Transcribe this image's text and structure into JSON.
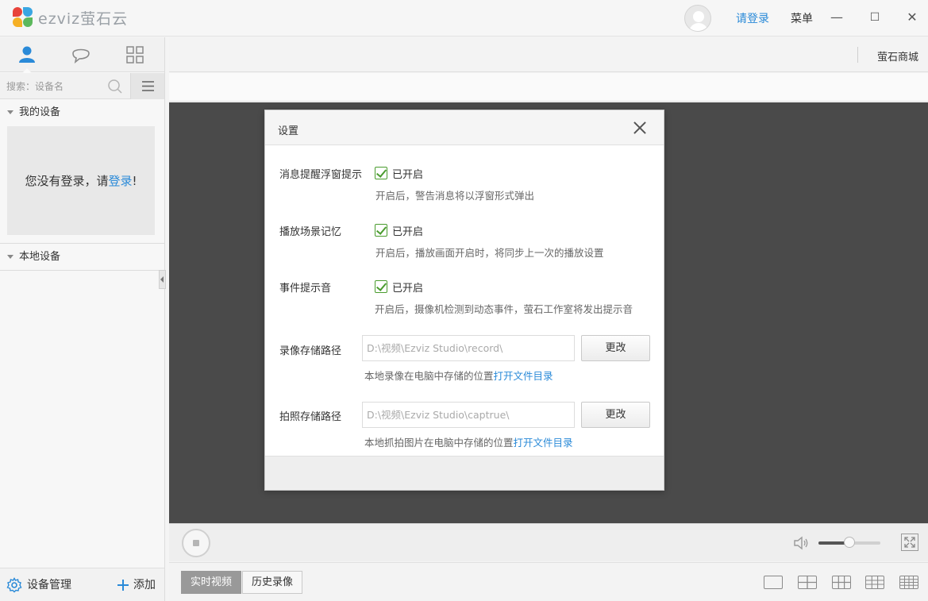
{
  "app": {
    "logo_text": "ezviz萤石云",
    "login_label": "请登录",
    "menu_label": "菜单",
    "minimize_glyph": "—",
    "maximize_glyph": "☐",
    "close_glyph": "✕"
  },
  "sidebar": {
    "tabs": [
      {
        "name": "user-icon"
      },
      {
        "name": "chat-icon"
      },
      {
        "name": "grid-icon"
      }
    ],
    "search_placeholder": "搜索：设备名",
    "my_devices": "我的设备",
    "login_prompt_prefix": "您没有登录，请",
    "login_prompt_link": "登录",
    "login_prompt_suffix": "!",
    "local_devices": "本地设备",
    "device_manage": "设备管理",
    "add": "添加"
  },
  "topbar": {
    "shop": "萤石商城"
  },
  "player": {
    "volume_level": 0.5,
    "tabs": [
      {
        "label": "实时视频",
        "active": true
      },
      {
        "label": "历史录像",
        "active": false
      }
    ],
    "layouts": [
      "1-view-icon",
      "4-view-icon",
      "6-view-icon",
      "9-view-icon",
      "16-view-icon"
    ]
  },
  "settings": {
    "title": "设置",
    "items": [
      {
        "label": "消息提醒浮窗提示",
        "checked": true,
        "state": "已开启",
        "hint": "开启后，警告消息将以浮窗形式弹出"
      },
      {
        "label": "播放场景记忆",
        "checked": true,
        "state": "已开启",
        "hint": "开启后，播放画面开启时，将同步上一次的播放设置"
      },
      {
        "label": "事件提示音",
        "checked": true,
        "state": "已开启",
        "hint": "开启后，摄像机检测到动态事件，萤石工作室将发出提示音"
      }
    ],
    "record_path": {
      "label": "录像存储路径",
      "value": "D:\\视频\\Ezviz Studio\\record\\",
      "button": "更改",
      "hint": "本地录像在电脑中存储的位置",
      "link": "打开文件目录"
    },
    "capture_path": {
      "label": "拍照存储路径",
      "value": "D:\\视频\\Ezviz Studio\\captrue\\",
      "button": "更改",
      "hint": "本地抓拍图片在电脑中存储的位置",
      "link": "打开文件目录"
    }
  },
  "colors": {
    "accent": "#2a8ad8",
    "check_green": "#4a9c2e",
    "video_bg": "#4a4a4a"
  }
}
